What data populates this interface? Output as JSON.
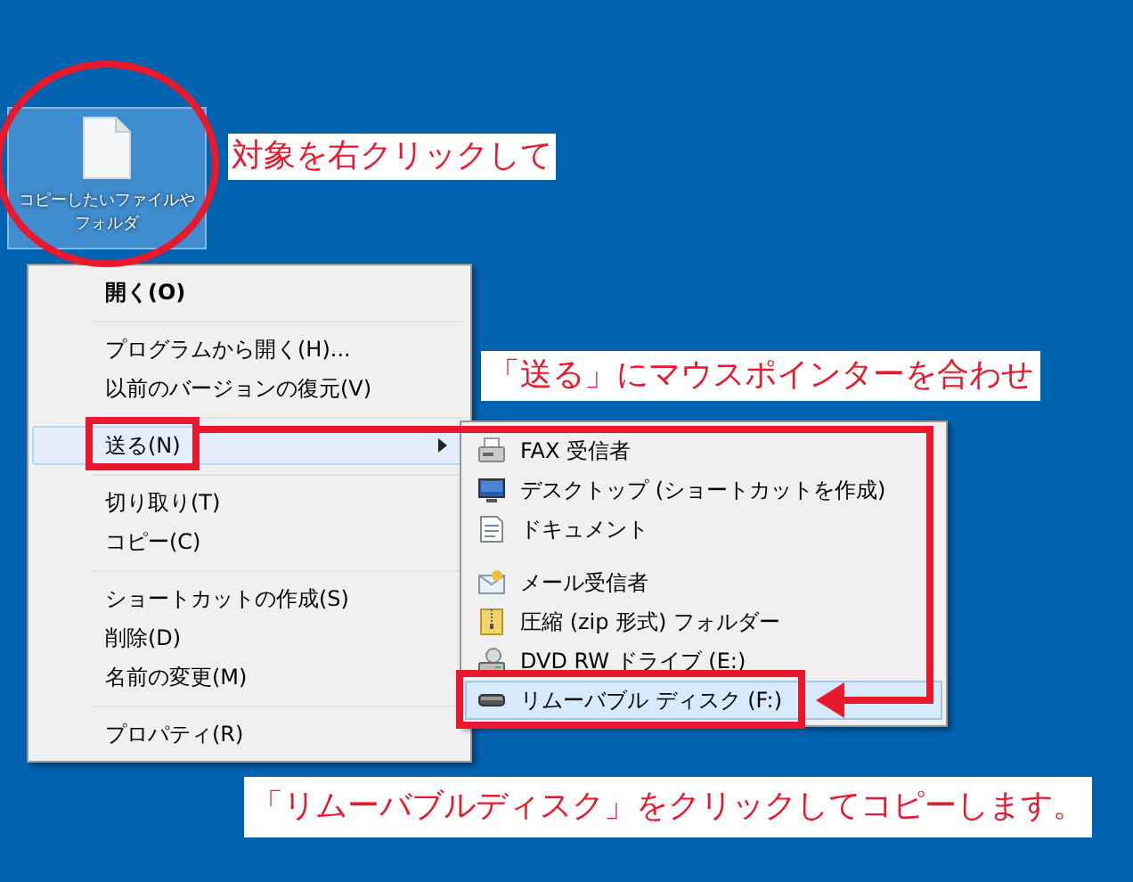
{
  "desktop_icon": {
    "label": "コピーしたいファイルやフォルダ",
    "selected": true
  },
  "callouts": [
    "対象を右クリックして",
    "「送る」にマウスポインターを合わせ",
    "「リムーバブルディスク」をクリックしてコピーします。"
  ],
  "context_menu": {
    "items": [
      {
        "kind": "item",
        "label": "開く(O)",
        "default": true,
        "submenu": false,
        "selected": false
      },
      {
        "kind": "separator"
      },
      {
        "kind": "item",
        "label": "プログラムから開く(H)...",
        "default": false,
        "submenu": false,
        "selected": false
      },
      {
        "kind": "item",
        "label": "以前のバージョンの復元(V)",
        "default": false,
        "submenu": false,
        "selected": false
      },
      {
        "kind": "separator"
      },
      {
        "kind": "item",
        "label": "送る(N)",
        "default": false,
        "submenu": true,
        "selected": true
      },
      {
        "kind": "separator"
      },
      {
        "kind": "item",
        "label": "切り取り(T)",
        "default": false,
        "submenu": false,
        "selected": false
      },
      {
        "kind": "item",
        "label": "コピー(C)",
        "default": false,
        "submenu": false,
        "selected": false
      },
      {
        "kind": "separator"
      },
      {
        "kind": "item",
        "label": "ショートカットの作成(S)",
        "default": false,
        "submenu": false,
        "selected": false
      },
      {
        "kind": "item",
        "label": "削除(D)",
        "default": false,
        "submenu": false,
        "selected": false
      },
      {
        "kind": "item",
        "label": "名前の変更(M)",
        "default": false,
        "submenu": false,
        "selected": false
      },
      {
        "kind": "separator"
      },
      {
        "kind": "item",
        "label": "プロパティ(R)",
        "default": false,
        "submenu": false,
        "selected": false
      }
    ]
  },
  "send_to_menu": {
    "items": [
      {
        "kind": "item",
        "label": "FAX 受信者",
        "selected": false
      },
      {
        "kind": "item",
        "label": "デスクトップ (ショートカットを作成)",
        "selected": false
      },
      {
        "kind": "item",
        "label": "ドキュメント",
        "selected": false
      },
      {
        "kind": "separator"
      },
      {
        "kind": "item",
        "label": "メール受信者",
        "selected": false
      },
      {
        "kind": "item",
        "label": "圧縮 (zip 形式) フォルダー",
        "selected": false
      },
      {
        "kind": "item",
        "label": "DVD RW ドライブ (E:)",
        "selected": false
      },
      {
        "kind": "item",
        "label": "リムーバブル ディスク (F:)",
        "selected": true
      }
    ]
  }
}
